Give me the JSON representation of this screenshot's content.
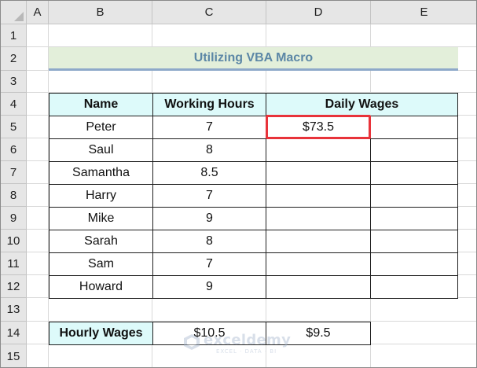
{
  "spreadsheet": {
    "column_headers": [
      "A",
      "B",
      "C",
      "D",
      "E"
    ],
    "row_headers": [
      "1",
      "2",
      "3",
      "4",
      "5",
      "6",
      "7",
      "8",
      "9",
      "10",
      "11",
      "12",
      "13",
      "14",
      "15"
    ]
  },
  "title": "Utilizing  VBA Macro",
  "table": {
    "headers": [
      "Name",
      "Working Hours",
      "Daily Wages"
    ],
    "rows": [
      {
        "name": "Peter",
        "hours": "7",
        "wage": "$73.5",
        "extra": ""
      },
      {
        "name": "Saul",
        "hours": "8",
        "wage": "",
        "extra": ""
      },
      {
        "name": "Samantha",
        "hours": "8.5",
        "wage": "",
        "extra": ""
      },
      {
        "name": "Harry",
        "hours": "7",
        "wage": "",
        "extra": ""
      },
      {
        "name": "Mike",
        "hours": "9",
        "wage": "",
        "extra": ""
      },
      {
        "name": "Sarah",
        "hours": "8",
        "wage": "",
        "extra": ""
      },
      {
        "name": "Sam",
        "hours": "7",
        "wage": "",
        "extra": ""
      },
      {
        "name": "Howard",
        "hours": "9",
        "wage": "",
        "extra": ""
      }
    ]
  },
  "hourly": {
    "label": "Hourly Wages",
    "value_1": "$10.5",
    "value_2": "$9.5"
  },
  "watermark": {
    "name": "exceldemy",
    "tagline": "EXCEL · DATA · BI"
  },
  "colors": {
    "title_bg": "#e3efda",
    "title_text": "#5c87a6",
    "header_bg": "#ddfafa",
    "highlight": "#e8333a"
  }
}
